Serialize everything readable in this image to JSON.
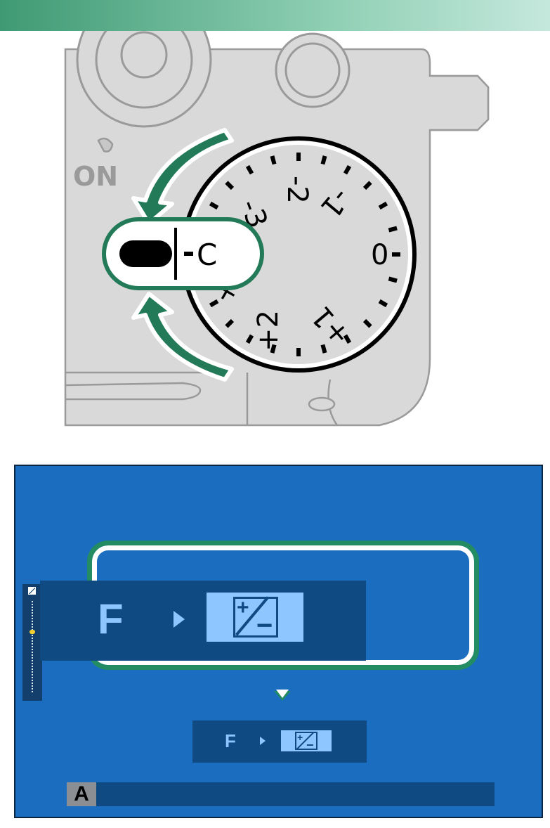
{
  "illustration": {
    "power_switch_label": "ON",
    "dial_labels": [
      "-2",
      "-1",
      "0",
      "+1",
      "+2",
      "+3",
      "-3"
    ],
    "dial_position_label": "C"
  },
  "screen": {
    "callout": {
      "function_label": "F",
      "arrow_icon": "right-triangle-icon",
      "target_icon": "exposure-compensation-icon"
    },
    "status_bar": {
      "function_label": "F",
      "arrow_icon": "right-triangle-icon",
      "target_icon": "exposure-compensation-icon"
    },
    "shooting_mode": "A"
  },
  "colors": {
    "accent_green": "#238c63",
    "screen_blue": "#1b6ebf",
    "panel_blue": "#0f4a83",
    "icon_blue": "#8ec7ff"
  }
}
